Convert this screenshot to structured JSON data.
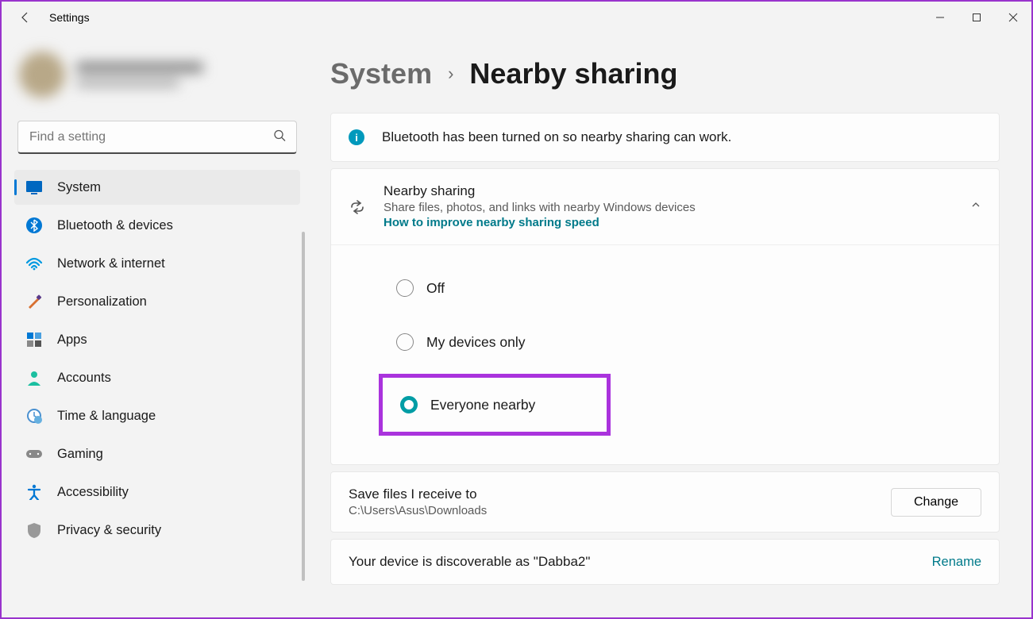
{
  "window": {
    "title": "Settings"
  },
  "search": {
    "placeholder": "Find a setting"
  },
  "nav": [
    {
      "label": "System",
      "icon": "system",
      "active": true
    },
    {
      "label": "Bluetooth & devices",
      "icon": "bluetooth"
    },
    {
      "label": "Network & internet",
      "icon": "wifi"
    },
    {
      "label": "Personalization",
      "icon": "paint"
    },
    {
      "label": "Apps",
      "icon": "apps"
    },
    {
      "label": "Accounts",
      "icon": "accounts"
    },
    {
      "label": "Time & language",
      "icon": "time"
    },
    {
      "label": "Gaming",
      "icon": "gaming"
    },
    {
      "label": "Accessibility",
      "icon": "accessibility"
    },
    {
      "label": "Privacy & security",
      "icon": "privacy"
    }
  ],
  "crumb": {
    "parent": "System",
    "current": "Nearby sharing"
  },
  "info": {
    "text": "Bluetooth has been turned on so nearby sharing can work."
  },
  "expander": {
    "title": "Nearby sharing",
    "sub": "Share files, photos, and links with nearby Windows devices",
    "link": "How to improve nearby sharing speed"
  },
  "radios": {
    "off": "Off",
    "mine": "My devices only",
    "everyone": "Everyone nearby",
    "selected": "everyone"
  },
  "savepath": {
    "title": "Save files I receive to",
    "path": "C:\\Users\\Asus\\Downloads",
    "button": "Change"
  },
  "discover": {
    "text": "Your device is discoverable as \"Dabba2\"",
    "action": "Rename"
  }
}
